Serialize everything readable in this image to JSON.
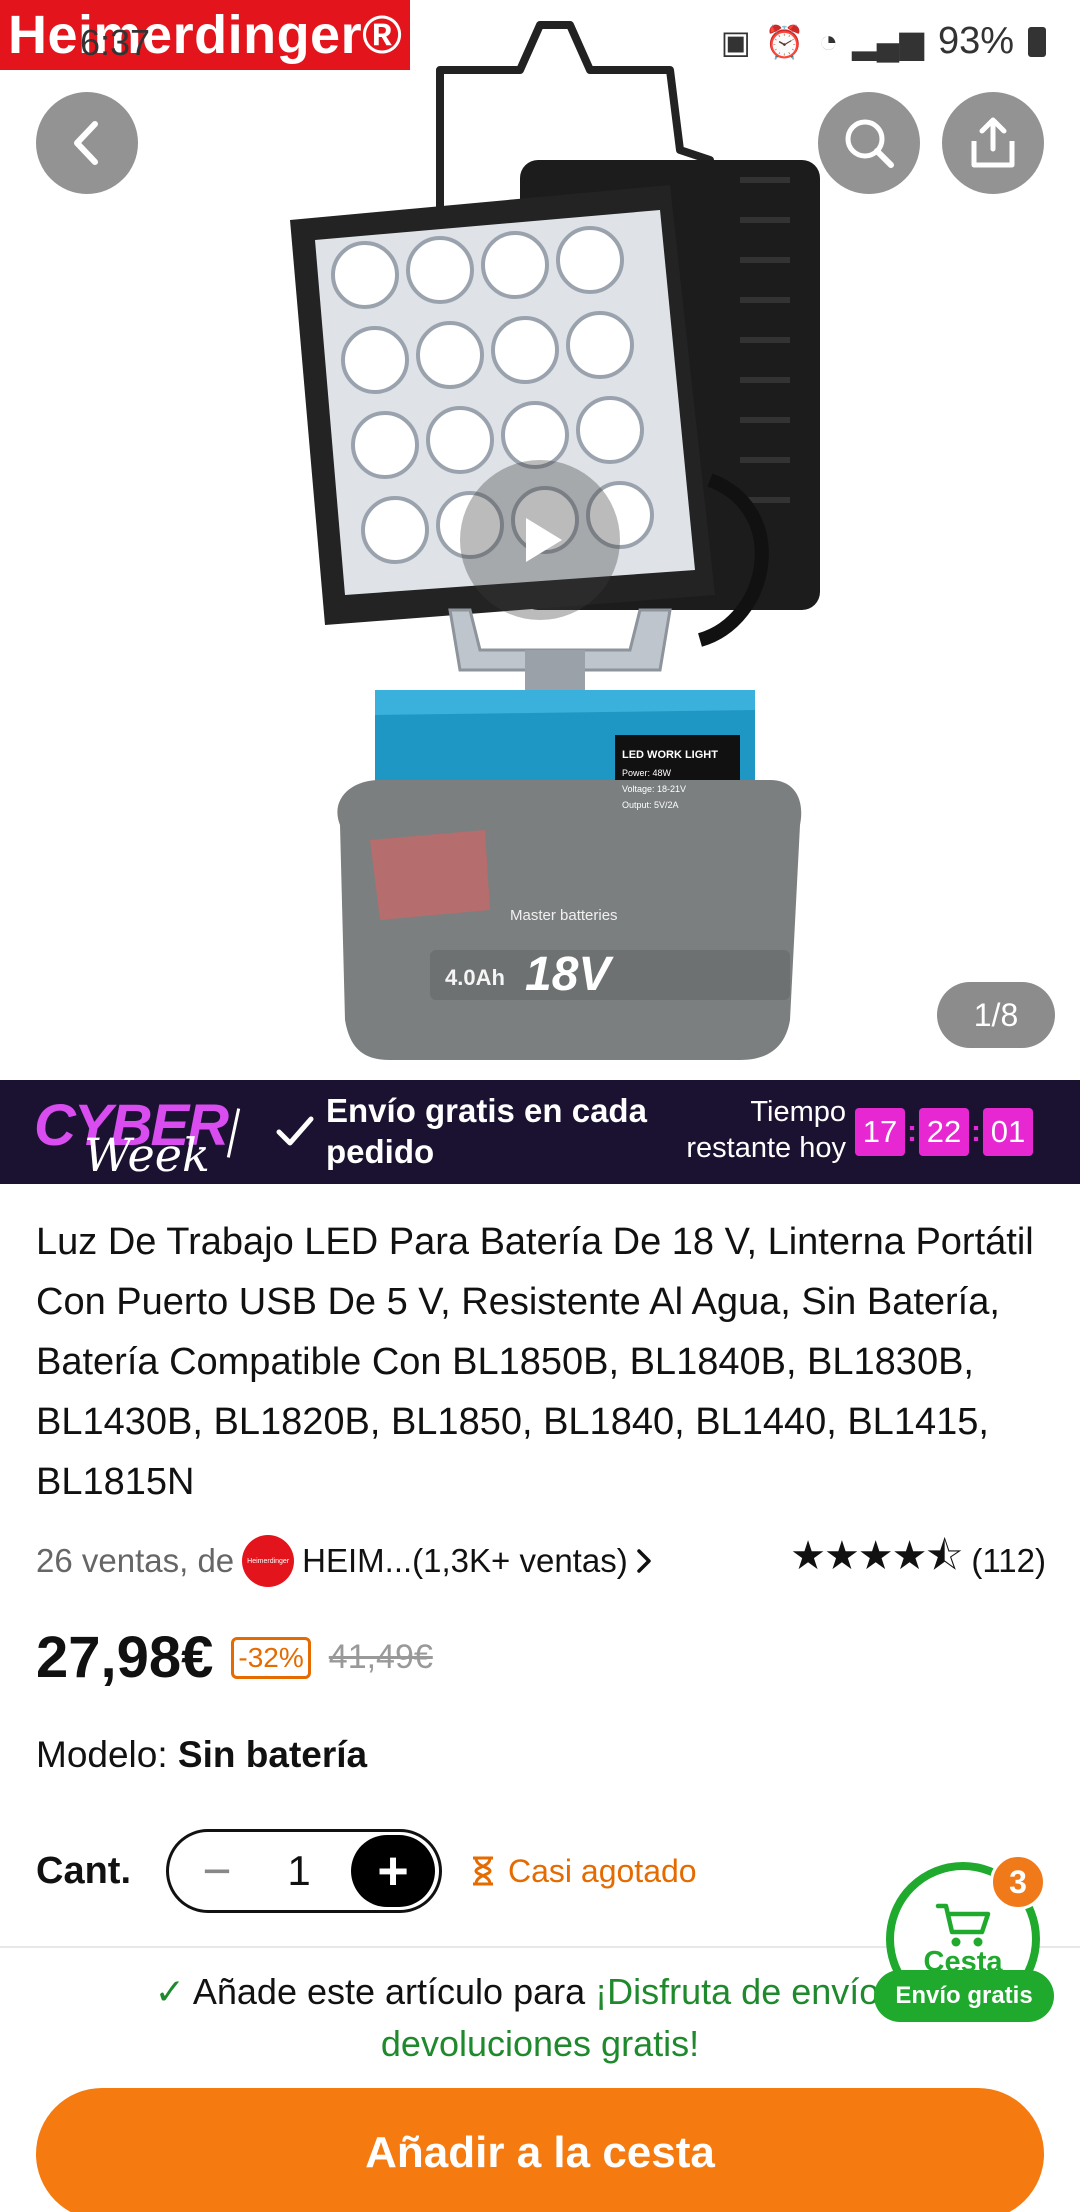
{
  "status_bar": {
    "time": "6:37",
    "battery": "93%"
  },
  "brand": {
    "name": "Heimerdinger®",
    "color": "#e3141c"
  },
  "gallery": {
    "counter": "1/8",
    "image_label_1": "LED WORK LIGHT",
    "image_label_2": "Power: 48W",
    "image_label_3": "Voltage: 18-21V",
    "image_label_4": "Output: 5V/2A",
    "battery_text": "Master batteries",
    "battery_capacity": "4.0Ah",
    "battery_voltage": "18V"
  },
  "promo": {
    "logo_top": "CYBER",
    "logo_bottom": "Week",
    "message": "Envío gratis en cada pedido",
    "time_label": "Tiempo restante hoy",
    "hours": "17",
    "minutes": "22",
    "seconds": "01",
    "accent": "#e627d2"
  },
  "product": {
    "title": "Luz De Trabajo LED Para Batería De 18 V, Linterna Portátil Con Puerto USB De 5 V, Resistente Al Agua, Sin Batería, Batería Compatible Con BL1850B, BL1840B, BL1830B, BL1430B, BL1820B, BL1850, BL1840, BL1440, BL1415, BL1815N",
    "sales": "26 ventas, de",
    "seller": "HEIM...(1,3K+ ventas)",
    "seller_logo_text": "Heimerdinger",
    "rating_count": "(112)",
    "rating": 4.5,
    "price": "27,98€",
    "discount": "-32%",
    "old_price": "41,49€",
    "model_label": "Modelo:",
    "model_value": "Sin batería"
  },
  "quantity": {
    "label": "Cant.",
    "value": "1",
    "stock_status": "Casi agotado"
  },
  "cart": {
    "label": "Cesta",
    "badge": "3",
    "free_shipping": "Envío gratis"
  },
  "footer": {
    "message_prefix": "Añade este artículo para",
    "message_highlight": "¡Disfruta de envíos y devoluciones gratis!",
    "add_to_cart": "Añadir a la cesta",
    "button_color": "#f57a10"
  }
}
